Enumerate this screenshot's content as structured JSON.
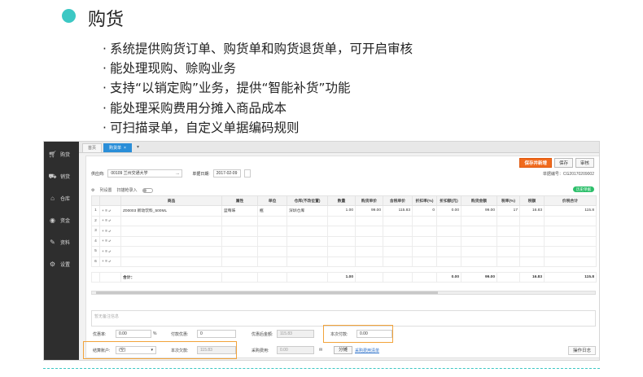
{
  "slide": {
    "title": "购货",
    "bullets": [
      "系统提供购货订单、购货单和购货退货单，可开启审核",
      "能处理现购、赊购业务",
      "支持“以销定购”业务，提供“智能补货”功能",
      "能处理采购费用分摊入商品成本",
      "可扫描录单，自定义单据编码规则"
    ]
  },
  "app": {
    "sidebar": [
      {
        "icon": "cart-icon",
        "label": "购货"
      },
      {
        "icon": "sales-icon",
        "label": "销货"
      },
      {
        "icon": "warehouse-icon",
        "label": "仓库"
      },
      {
        "icon": "funds-icon",
        "label": "资金"
      },
      {
        "icon": "data-icon",
        "label": "资料"
      },
      {
        "icon": "gear-icon",
        "label": "设置"
      }
    ],
    "tabs": {
      "home": "首页",
      "active": "购货单",
      "close": "×",
      "more": "▾"
    },
    "buttons": {
      "save_new": "保存并新增",
      "save": "保存",
      "audit": "审核"
    },
    "doc_number": "单据编号：CG20170209002",
    "header": {
      "supplier_label": "供应商:",
      "supplier_value": "00109 兰州交通大学",
      "supplier_more": "...",
      "date_label": "单据日期:",
      "date_value": "2017-02-09"
    },
    "options": {
      "columns": "列设置",
      "scan": "扫描枪录入"
    },
    "history_badge": "历史单据",
    "grid": {
      "columns": [
        "",
        "",
        "商品",
        "属性",
        "单位",
        "仓库(不改位置)",
        "数量",
        "购货单价",
        "含税单价",
        "折扣率(%)",
        "折扣额(元)",
        "购货金额",
        "税率(%)",
        "税额",
        "价税合计"
      ],
      "rows": [
        {
          "idx": "1",
          "ops": "+ ≡ ⤶",
          "item": "Z00003 新动饮料_500ML",
          "attr": "蓝莓味",
          "unit": "瓶",
          "wh": "深圳仓库",
          "qty": "1.00",
          "price": "99.00",
          "tax_price": "115.83",
          "disc_rate": "0",
          "disc_amt": "0.00",
          "amount": "99.00",
          "tax_rate": "17",
          "tax": "16.83",
          "total": "115.8"
        },
        {
          "idx": "2",
          "ops": "+ ≡ ⤶"
        },
        {
          "idx": "3",
          "ops": "+ ≡ ⤶"
        },
        {
          "idx": "4",
          "ops": "+ ≡ ⤶"
        },
        {
          "idx": "5",
          "ops": "+ ≡ ⤶"
        },
        {
          "idx": "6",
          "ops": "+ ≡ ⤶"
        }
      ],
      "total": {
        "label": "合计：",
        "qty": "1.00",
        "disc_amt": "0.00",
        "amount": "99.00",
        "tax": "16.83",
        "total": "115.8"
      }
    },
    "remark_placeholder": "暂无备注信息",
    "footer": {
      "discount_rate_label": "优惠率:",
      "discount_rate": "0.00",
      "percent": "%",
      "discount_amt_label": "付款优惠:",
      "discount_amt": "0",
      "after_discount_label": "优惠后金额:",
      "after_discount": "115.83",
      "paid_label": "本次付款:",
      "paid": "0.00",
      "account_label": "结算账户:",
      "account_value": "(空)",
      "debt_label": "本次欠款:",
      "debt": "115.83",
      "purchase_fee_label": "采购费用:",
      "purchase_fee": "0.00",
      "allocate_btn": "分摊",
      "allocate_link": "采购费用清单",
      "log_btn": "操作日志"
    }
  }
}
